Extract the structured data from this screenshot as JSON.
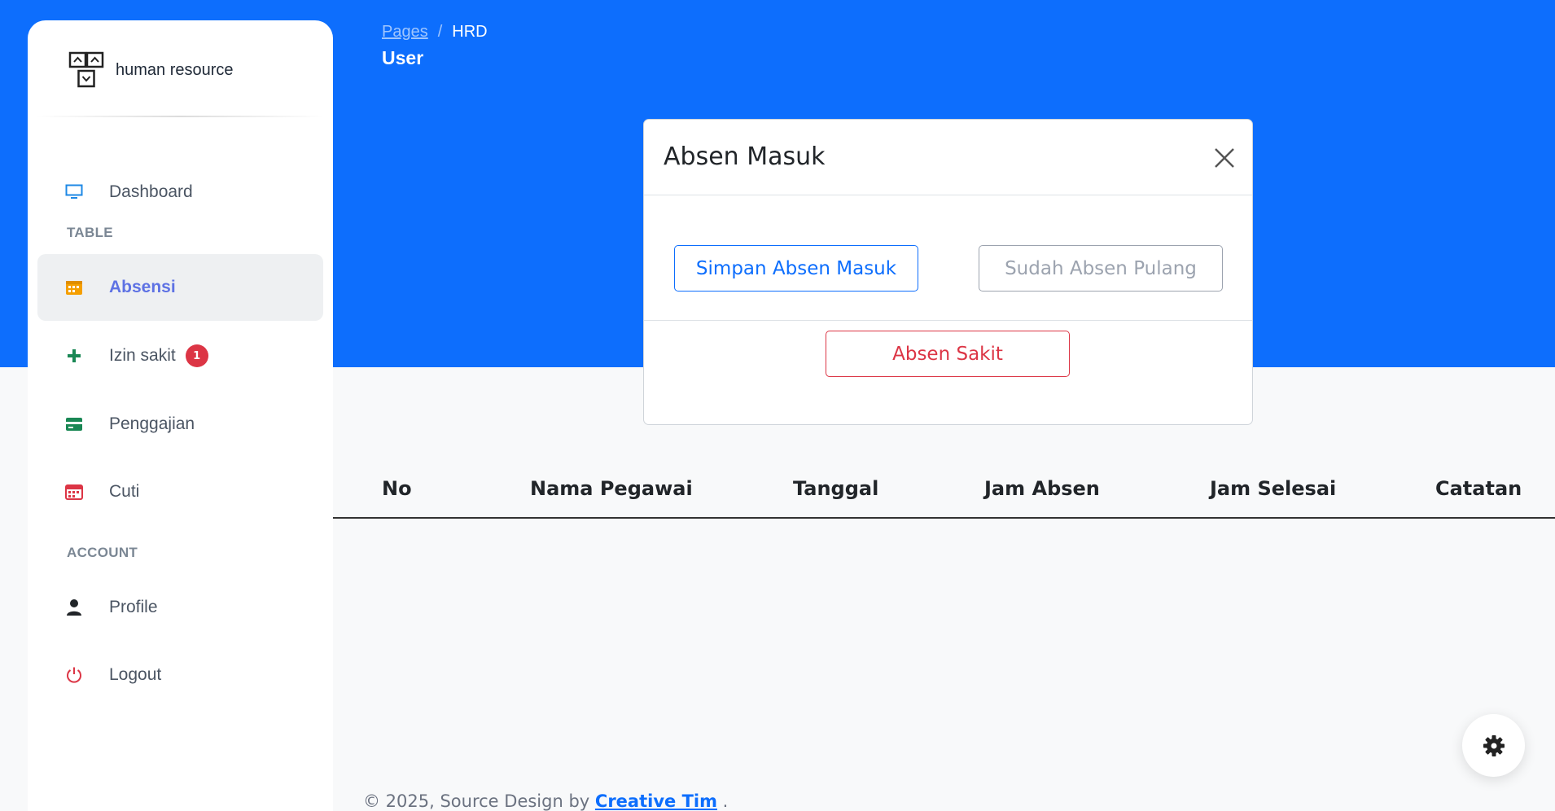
{
  "sidebar": {
    "brand": "human resource",
    "items": [
      {
        "label": "Dashboard",
        "icon": "monitor-icon",
        "color": "#1e88e5"
      },
      {
        "label": "Absensi",
        "icon": "calendar-icon",
        "color": "#f59f00",
        "active": true
      },
      {
        "label": "Izin sakit",
        "icon": "plus-icon",
        "color": "#198754",
        "badge": "1"
      },
      {
        "label": "Penggajian",
        "icon": "credit-card-icon",
        "color": "#198754"
      },
      {
        "label": "Cuti",
        "icon": "calendar-icon",
        "color": "#dc3545"
      },
      {
        "label": "Profile",
        "icon": "user-icon",
        "color": "#212529"
      },
      {
        "label": "Logout",
        "icon": "power-icon",
        "color": "#dc3545"
      }
    ],
    "sections": {
      "table": "TABLE",
      "account": "ACCOUNT"
    }
  },
  "breadcrumb": {
    "parent": "Pages",
    "separator": "/",
    "current": "HRD"
  },
  "page_title": "User",
  "table": {
    "headers": [
      "No",
      "Nama Pegawai",
      "Tanggal",
      "Jam Absen",
      "Jam Selesai",
      "Catatan"
    ]
  },
  "modal": {
    "title": "Absen Masuk",
    "buttons": {
      "simpan": "Simpan Absen Masuk",
      "pulang": "Sudah Absen Pulang",
      "sakit": "Absen Sakit"
    }
  },
  "footer": {
    "prefix": "© 2025, Source Design by",
    "link": "Creative Tim",
    "suffix": "."
  },
  "colors": {
    "primary": "#0d6efd",
    "danger": "#dc3545",
    "active_nav": "#5e72e4"
  }
}
